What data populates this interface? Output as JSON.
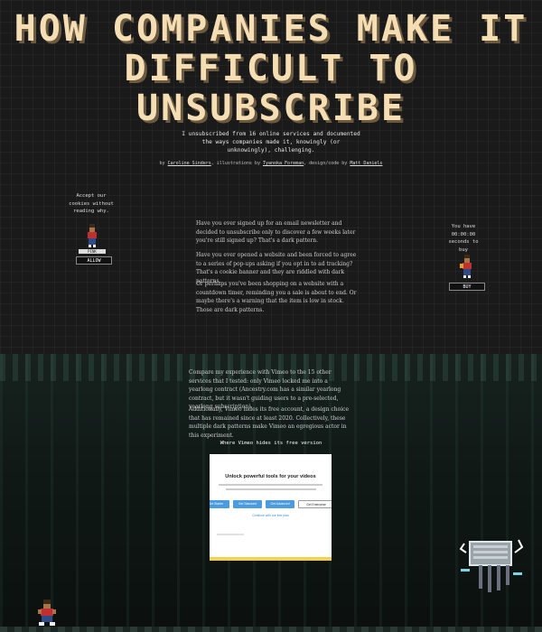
{
  "hero": {
    "title": "HOW COMPANIES MAKE IT DIFFICULT TO UNSUBSCRIBE",
    "subtitle": "I unsubscribed from 16 online services and documented the ways companies made it, knowingly (or unknowingly), challenging.",
    "credits": {
      "by": "by",
      "author": "Caroline Sinders",
      "illus_prefix": ", illustrations by",
      "illustrator": "Tyanoka Foreman",
      "design_prefix": ", design/code by",
      "designer": "Matt Daniels"
    }
  },
  "left_widget": {
    "text": "Accept our cookies without reading why.",
    "sprite_label": "PINK",
    "button": "ALLOW"
  },
  "right_widget": {
    "text_prefix": "You have",
    "timer": "00:00:00",
    "text_suffix": "seconds to buy",
    "button": "BUY"
  },
  "intro": [
    "Have you ever signed up for an email newsletter and decided to unsubscribe only to discover a few weeks later you're still signed up? That's a dark pattern.",
    "Have you ever opened a website and been forced to agree to a series of pop-ups asking if you opt in to ad tracking? That's a cookie banner and they are riddled with dark patterns.",
    "Or perhaps you've been shopping on a website with a countdown timer, reminding you a sale is about to end. Or maybe there's a warning that the item is low in stock. Those are dark patterns."
  ],
  "body": [
    "Compare my experience with Vimeo to the 15 other services that I tested: only Vimeo locked me into a yearlong contract (Ancestry.com has a similar yearlong contract, but it wasn't guiding users to a pre-selected, yearlong subscription).",
    "Additionally, Vimeo hides its free account, a design choice that has remained since at least 2020. Collectively, these multiple dark patterns make Vimeo an egregious actor in this experiment."
  ],
  "figure": {
    "caption": "Where Vimeo hides its free version",
    "heading": "Unlock powerful tools for your videos",
    "plans": [
      "Get Starter",
      "Get Standard",
      "Get Advanced",
      "Get Enterprise"
    ],
    "link": "Continue with our free plan"
  },
  "colors": {
    "title": "#f6deb4",
    "title_shadow": "#6b5a40",
    "background": "#1a1a1a",
    "plan_blue": "#4a9be0",
    "bar_yellow": "#f2d34a"
  }
}
